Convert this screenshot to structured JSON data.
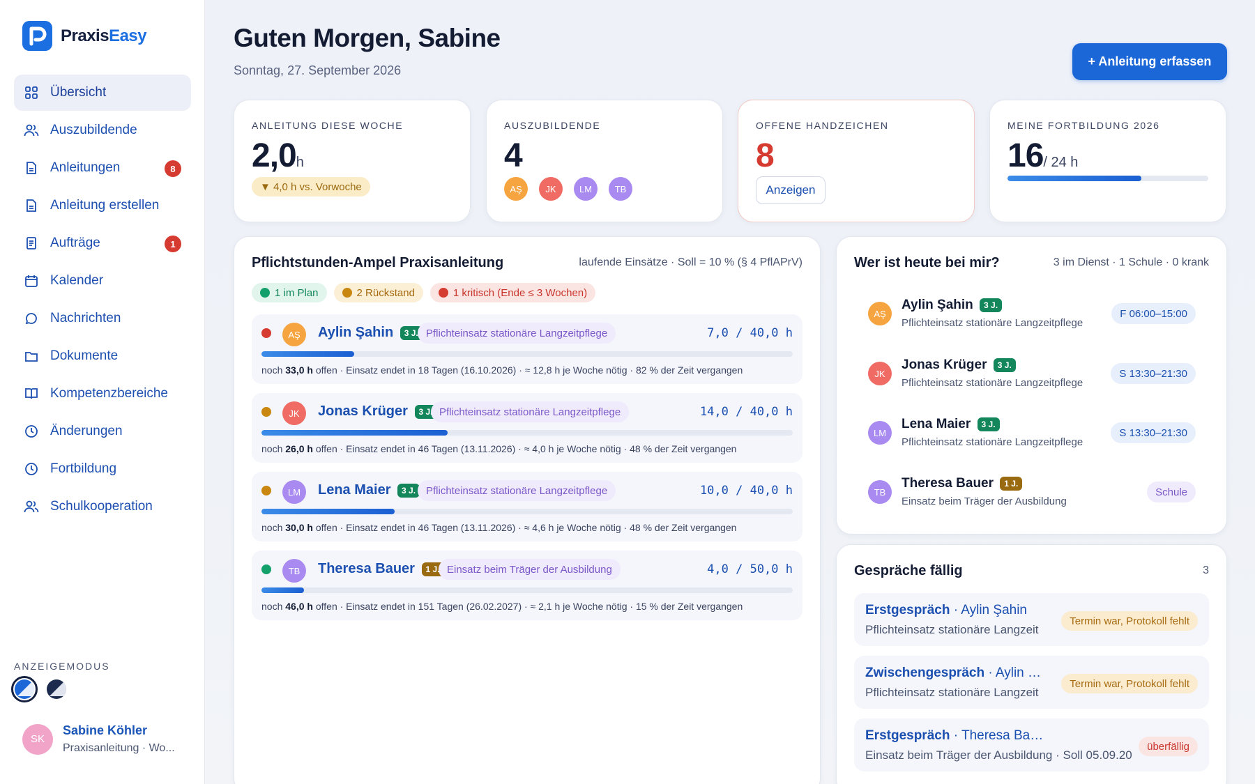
{
  "app": {
    "logo_first": "Praxis",
    "logo_second": "Easy"
  },
  "nav": [
    {
      "label": "Übersicht",
      "icon": "grid-icon",
      "active": true
    },
    {
      "label": "Auszubildende",
      "icon": "users-icon"
    },
    {
      "label": "Anleitungen",
      "icon": "document-icon",
      "badge": "8"
    },
    {
      "label": "Anleitung erstellen",
      "icon": "document-icon"
    },
    {
      "label": "Aufträge",
      "icon": "clipboard-icon",
      "badge": "1"
    },
    {
      "label": "Kalender",
      "icon": "calendar-icon"
    },
    {
      "label": "Nachrichten",
      "icon": "chat-icon"
    },
    {
      "label": "Dokumente",
      "icon": "folder-icon"
    },
    {
      "label": "Kompetenzbereiche",
      "icon": "book-icon"
    },
    {
      "label": "Änderungen",
      "icon": "clock-icon"
    },
    {
      "label": "Fortbildung",
      "icon": "clock-icon"
    },
    {
      "label": "Schulkooperation",
      "icon": "users-icon"
    }
  ],
  "display_mode": {
    "label": "ANZEIGEMODUS"
  },
  "user": {
    "initials": "SK",
    "name": "Sabine Köhler",
    "role": "Praxisanleitung · Wo..."
  },
  "header": {
    "greeting": "Guten Morgen, Sabine",
    "date": "Sonntag, 27. September 2026",
    "action": "+ Anleitung erfassen"
  },
  "kpis": {
    "week": {
      "label": "ANLEITUNG DIESE WOCHE",
      "value": "2,0",
      "unit": "h",
      "change": "▼ 4,0 h vs. Vorwoche"
    },
    "trainees": {
      "label": "AUSZUBILDENDE",
      "value": "4",
      "avatars": [
        "AŞ",
        "JK",
        "LM",
        "TB"
      ]
    },
    "signatures": {
      "label": "OFFENE HANDZEICHEN",
      "value": "8",
      "button": "Anzeigen"
    },
    "training": {
      "label": "MEINE FORTBILDUNG 2026",
      "value": "16",
      "unit": "/ 24 h",
      "progress": 0.667
    }
  },
  "ampel": {
    "title": "Pflichtstunden-Ampel Praxisanleitung",
    "meta": "laufende Einsätze · Soll = 10 % (§ 4 PflAPrV)",
    "legend": {
      "green": "1 im Plan",
      "orange": "2 Rückstand",
      "red": "1 kritisch (Ende ≤ 3 Wochen)"
    },
    "rows": [
      {
        "initials": "AŞ",
        "name": "Aylin Şahin",
        "year": "3 J.",
        "tag": "Pflichteinsatz stationäre Langzeitpflege",
        "hours": "7,0 / 40,0 h",
        "progress": 0.175,
        "open": "33,0 h",
        "info": "offen · Einsatz endet in 18 Tagen (16.10.2026) · ≈ 12,8 h je Woche nötig · 82 % der Zeit vergangen",
        "status": "red"
      },
      {
        "initials": "JK",
        "name": "Jonas Krüger",
        "year": "3 J.",
        "tag": "Pflichteinsatz stationäre Langzeitpflege",
        "hours": "14,0 / 40,0 h",
        "progress": 0.35,
        "open": "26,0 h",
        "info": "offen · Einsatz endet in 46 Tagen (13.11.2026) · ≈ 4,0 h je Woche nötig · 48 % der Zeit vergangen",
        "status": "orange"
      },
      {
        "initials": "LM",
        "name": "Lena Maier",
        "year": "3 J.",
        "tag": "Pflichteinsatz stationäre Langzeitpflege",
        "hours": "10,0 / 40,0 h",
        "progress": 0.25,
        "open": "30,0 h",
        "info": "offen · Einsatz endet in 46 Tagen (13.11.2026) · ≈ 4,6 h je Woche nötig · 48 % der Zeit vergangen",
        "status": "orange"
      },
      {
        "initials": "TB",
        "name": "Theresa Bauer",
        "year": "1 J.",
        "tag": "Einsatz beim Träger der Ausbildung",
        "hours": "4,0 / 50,0 h",
        "progress": 0.08,
        "open": "46,0 h",
        "info": "offen · Einsatz endet in 151 Tagen (26.02.2027) · ≈ 2,1 h je Woche nötig · 15 % der Zeit vergangen",
        "status": "green"
      }
    ]
  },
  "duty": {
    "title": "Wer ist heute bei mir?",
    "meta": "3 im Dienst · 1 Schule · 0 krank",
    "items": [
      {
        "initials": "AŞ",
        "name": "Aylin Şahin",
        "year": "3 J.",
        "sub": "Pflichteinsatz stationäre Langzeitpflege",
        "shift": "F 06:00–15:00"
      },
      {
        "initials": "JK",
        "name": "Jonas Krüger",
        "year": "3 J.",
        "sub": "Pflichteinsatz stationäre Langzeitpflege",
        "shift": "S 13:30–21:30"
      },
      {
        "initials": "LM",
        "name": "Lena Maier",
        "year": "3 J.",
        "sub": "Pflichteinsatz stationäre Langzeitpflege",
        "shift": "S 13:30–21:30"
      },
      {
        "initials": "TB",
        "name": "Theresa Bauer",
        "year": "1 J.",
        "sub": "Einsatz beim Träger der Ausbildung",
        "shift": "Schule"
      }
    ]
  },
  "gespraeche": {
    "title": "Gespräche fällig",
    "count": "3",
    "items": [
      {
        "type": "Erstgespräch",
        "person": " · Aylin Şahin",
        "sub": "Pflichteinsatz stationäre Langzeit",
        "badge": "Termin war, Protokoll fehlt"
      },
      {
        "type": "Zwischengespräch",
        "person": " · Aylin Ş...",
        "sub": "Pflichteinsatz stationäre Langzeit",
        "badge": "Termin war, Protokoll fehlt"
      },
      {
        "type": "Erstgespräch",
        "person": " · Theresa Bauer",
        "sub": "Einsatz beim Träger der Ausbildung · Soll 05.09.20",
        "badge": "überfällig"
      }
    ]
  },
  "colors": {
    "primary": "#1b67d8",
    "green": "#13a06b",
    "orange": "#c98710",
    "red": "#d63b32",
    "av_as": "#f5a43f",
    "av_jk": "#ef6b63",
    "av_lm": "#a98af0",
    "av_tb": "#a98af0",
    "year3": "#13875b",
    "year1": "#9a6a10"
  }
}
